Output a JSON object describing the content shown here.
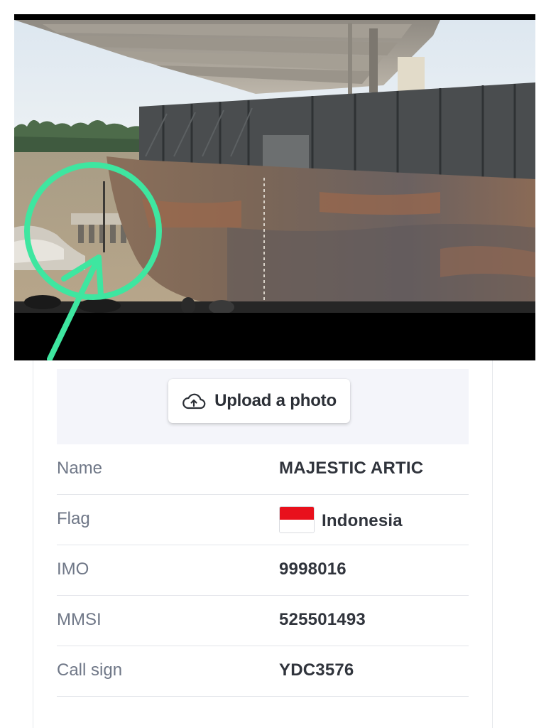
{
  "upload": {
    "label": "Upload a photo",
    "icon": "cloud-upload-icon"
  },
  "details": [
    {
      "key": "Name",
      "value": "MAJESTIC ARTIC"
    },
    {
      "key": "Flag",
      "value": "Indonesia",
      "flag_colors": [
        "#e8101c",
        "#ffffff"
      ]
    },
    {
      "key": "IMO",
      "value": "9998016"
    },
    {
      "key": "MMSI",
      "value": "525501493"
    },
    {
      "key": "Call sign",
      "value": "YDC3576"
    }
  ],
  "colors": {
    "annotation": "#3ee6a0",
    "key_text": "#6f7787",
    "value_text": "#30343c",
    "upload_area_bg": "#f4f5fa"
  }
}
